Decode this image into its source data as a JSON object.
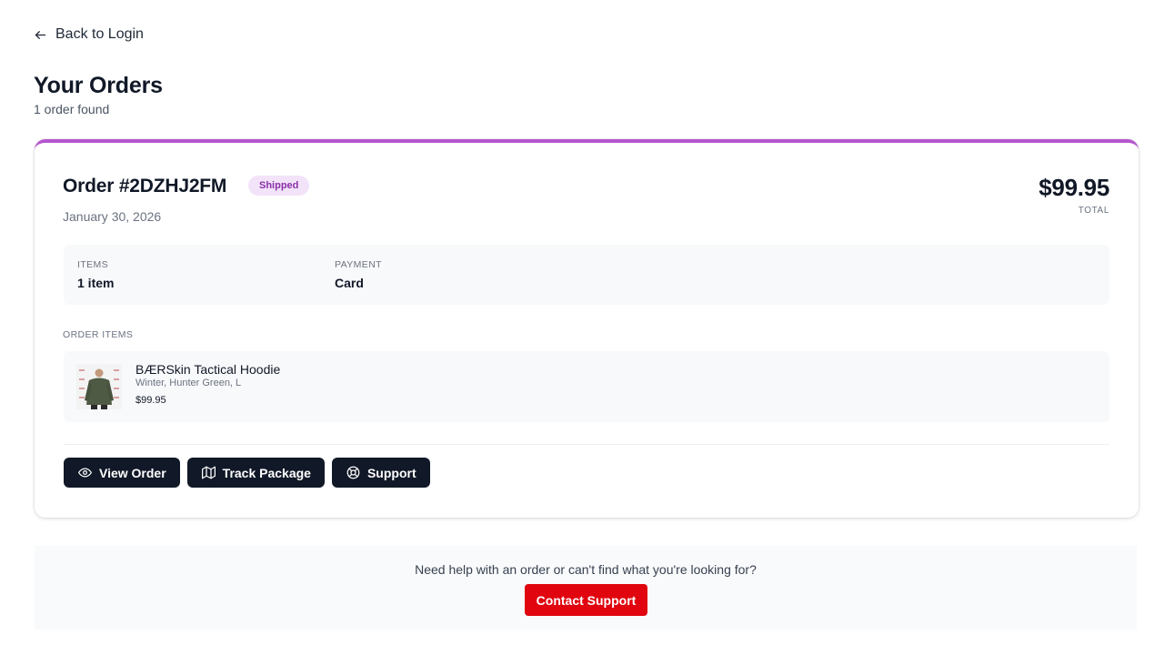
{
  "nav": {
    "back_label": "Back to Login"
  },
  "page": {
    "title": "Your Orders",
    "subtitle": "1 order found"
  },
  "order": {
    "number": "Order #2DZHJ2FM",
    "status": "Shipped",
    "date": "January 30, 2026",
    "total": "$99.95",
    "total_label": "TOTAL",
    "summary": [
      {
        "label": "ITEMS",
        "value": "1 item"
      },
      {
        "label": "PAYMENT",
        "value": "Card"
      }
    ],
    "items_heading": "ORDER ITEMS",
    "items": [
      {
        "name": "BÆRSkin Tactical Hoodie",
        "variant": "Winter, Hunter Green, L",
        "price": "$99.95"
      }
    ],
    "actions": {
      "view_order": "View Order",
      "track_package": "Track Package",
      "support": "Support"
    }
  },
  "help": {
    "text": "Need help with an order or can't find what you're looking for?",
    "button": "Contact Support"
  },
  "colors": {
    "accent_bar": "#b556cf",
    "badge_bg": "#f3e3f9",
    "badge_text": "#8a2fa8",
    "dark_button": "#111827",
    "contact_button": "#e0050f"
  },
  "icons": {
    "back": "arrow-left-icon",
    "view_order": "eye-icon",
    "track_package": "map-icon",
    "support": "life-buoy-icon"
  }
}
